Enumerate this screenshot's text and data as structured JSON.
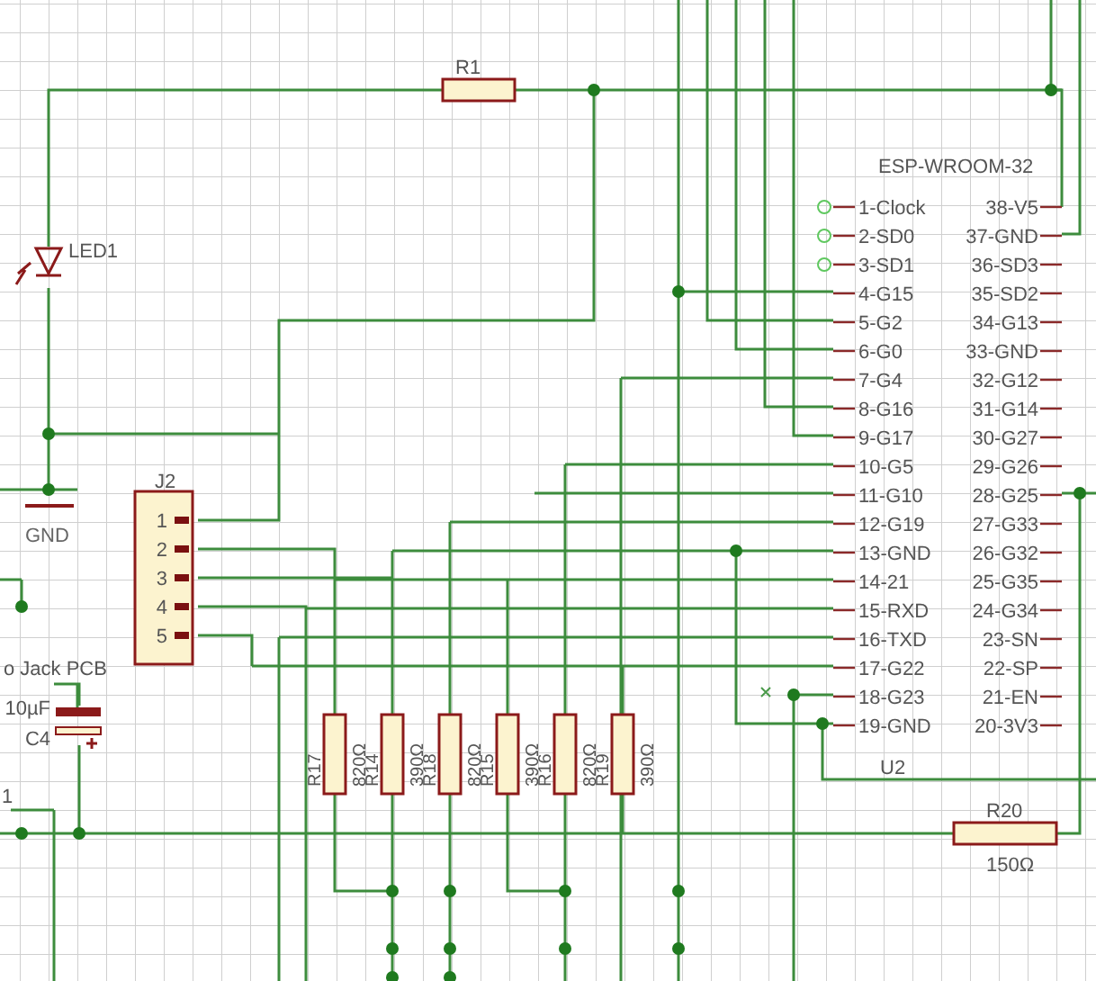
{
  "r1": {
    "name": "R1"
  },
  "led1": {
    "name": "LED1"
  },
  "gnd": {
    "label": "GND"
  },
  "j2": {
    "name": "J2",
    "pins": [
      "1",
      "2",
      "3",
      "4",
      "5"
    ]
  },
  "c4": {
    "part": "o Jack PCB",
    "value": "10µF",
    "name": "C4"
  },
  "edge_label": "1",
  "resistor_bank": [
    {
      "name": "R17",
      "value": "820Ω"
    },
    {
      "name": "R14",
      "value": "390Ω"
    },
    {
      "name": "R18",
      "value": "820Ω"
    },
    {
      "name": "R15",
      "value": "390Ω"
    },
    {
      "name": "R16",
      "value": "820Ω"
    },
    {
      "name": "R19",
      "value": "390Ω"
    }
  ],
  "r20": {
    "name": "R20",
    "value": "150Ω"
  },
  "esp": {
    "title": "ESP-WROOM-32",
    "ref": "U2",
    "left_pins": [
      "1-Clock",
      "2-SD0",
      "3-SD1",
      "4-G15",
      "5-G2",
      "6-G0",
      "7-G4",
      "8-G16",
      "9-G17",
      "10-G5",
      "11-G10",
      "12-G19",
      "13-GND",
      "14-21",
      "15-RXD",
      "16-TXD",
      "17-G22",
      "18-G23",
      "19-GND"
    ],
    "right_pins": [
      "38-V5",
      "37-GND",
      "36-SD3",
      "35-SD2",
      "34-G13",
      "33-GND",
      "32-G12",
      "31-G14",
      "30-G27",
      "29-G26",
      "28-G25",
      "27-G33",
      "26-G32",
      "25-G35",
      "24-G34",
      "23-SN",
      "22-SP",
      "21-EN",
      "20-3V3"
    ]
  }
}
